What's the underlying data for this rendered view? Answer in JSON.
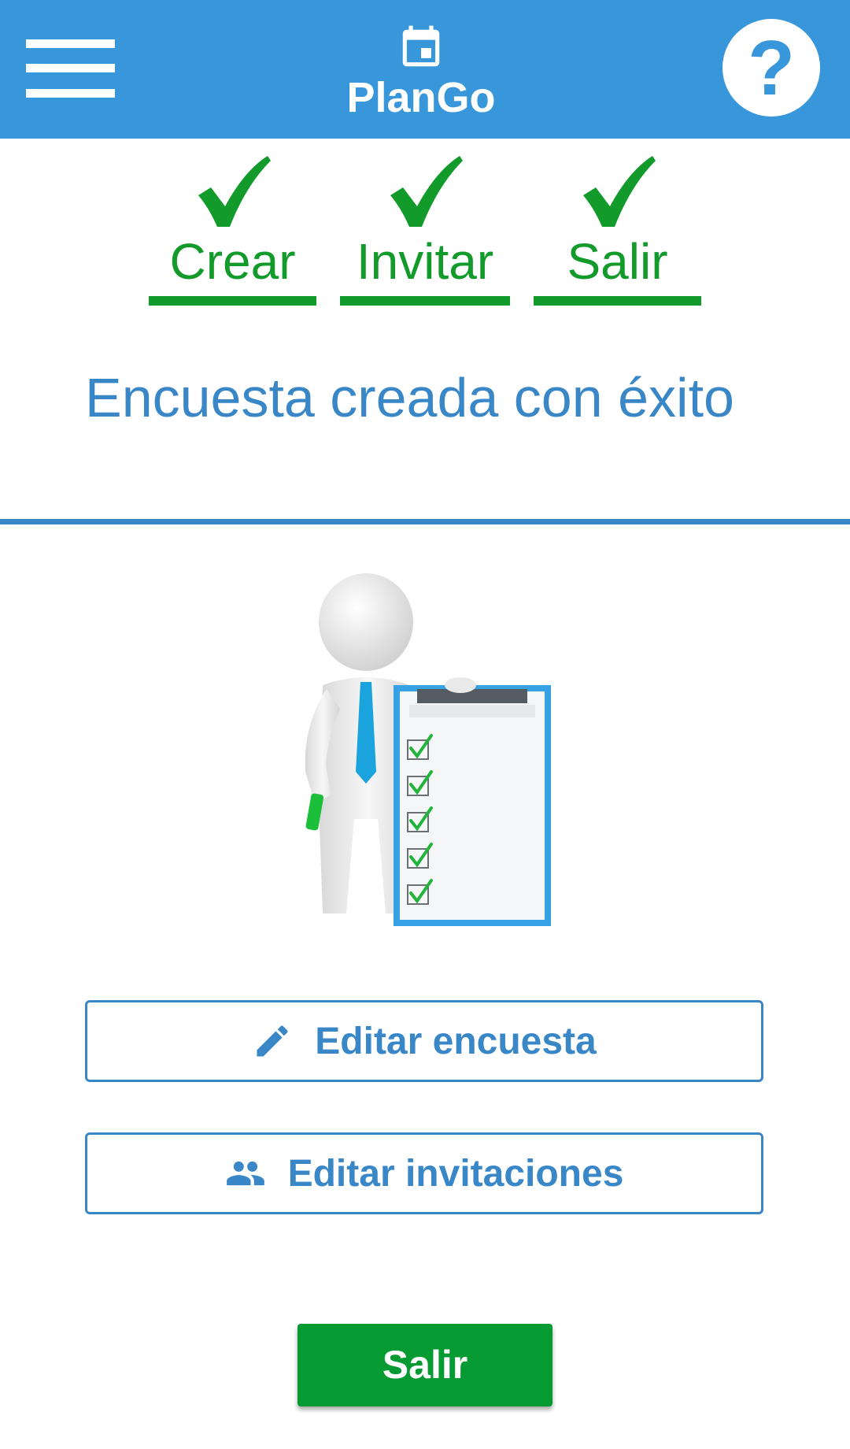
{
  "app": {
    "title": "PlanGo",
    "brand_icon": "calendar-icon",
    "menu_icon": "hamburger-menu-icon",
    "help_label": "?",
    "help_icon": "help-icon"
  },
  "steps": [
    {
      "label": "Crear",
      "completed": true,
      "icon": "checkmark-icon"
    },
    {
      "label": "Invitar",
      "completed": true,
      "icon": "checkmark-icon"
    },
    {
      "label": "Salir",
      "completed": true,
      "icon": "checkmark-icon"
    }
  ],
  "main": {
    "title": "Encuesta creada con éxito",
    "illustration": "person-with-checklist-illustration"
  },
  "actions": {
    "edit_survey": {
      "label": "Editar encuesta",
      "icon": "pencil-icon"
    },
    "edit_invites": {
      "label": "Editar invitaciones",
      "icon": "people-icon"
    },
    "exit": {
      "label": "Salir"
    }
  },
  "colors": {
    "header_bg": "#3897da",
    "primary_blue": "#3a87c8",
    "success_green": "#129a2b",
    "exit_button_green": "#069a33",
    "white": "#ffffff"
  }
}
